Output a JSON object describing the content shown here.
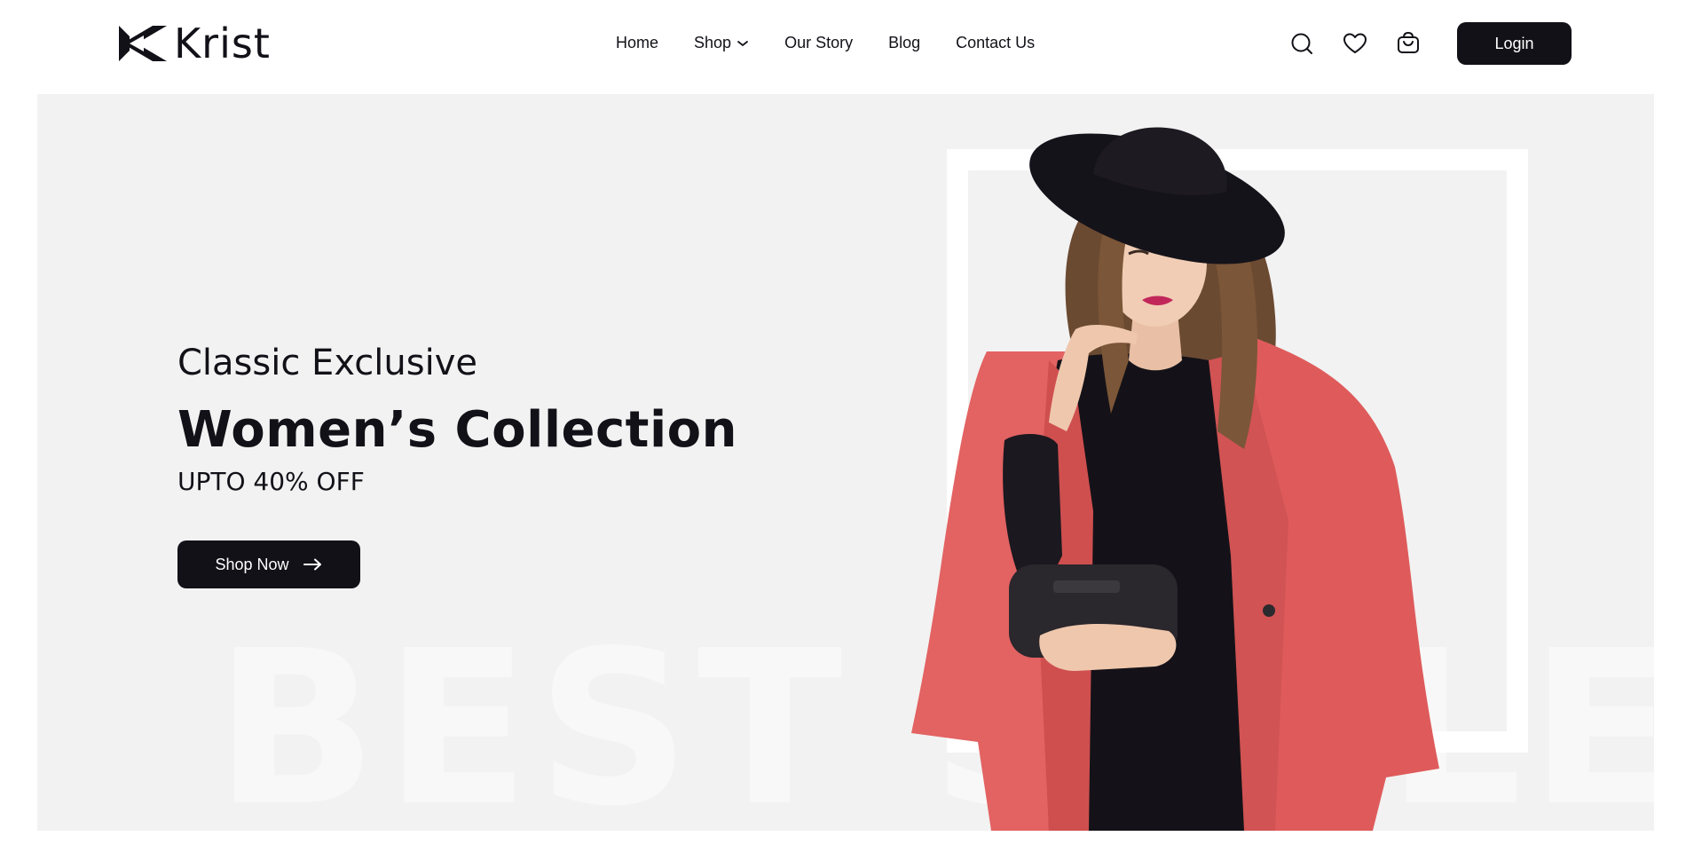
{
  "brand": {
    "name": "Krist",
    "logo_icon": "krist-k-logo"
  },
  "nav": {
    "items": [
      {
        "label": "Home",
        "has_dropdown": false
      },
      {
        "label": "Shop",
        "has_dropdown": true
      },
      {
        "label": "Our Story",
        "has_dropdown": false
      },
      {
        "label": "Blog",
        "has_dropdown": false
      },
      {
        "label": "Contact Us",
        "has_dropdown": false
      }
    ]
  },
  "header_icons": [
    "search-icon",
    "heart-icon",
    "cart-icon"
  ],
  "login": {
    "label": "Login"
  },
  "hero": {
    "subtitle": "Classic Exclusive",
    "title": "Women’s Collection",
    "offer": "UPTO 40% OFF",
    "cta_label": "Shop Now",
    "watermark": "BEST SELLER"
  },
  "colors": {
    "primary": "#131118",
    "hero_bg": "#f2f2f2",
    "coat": "#e05a5a",
    "white": "#ffffff"
  }
}
